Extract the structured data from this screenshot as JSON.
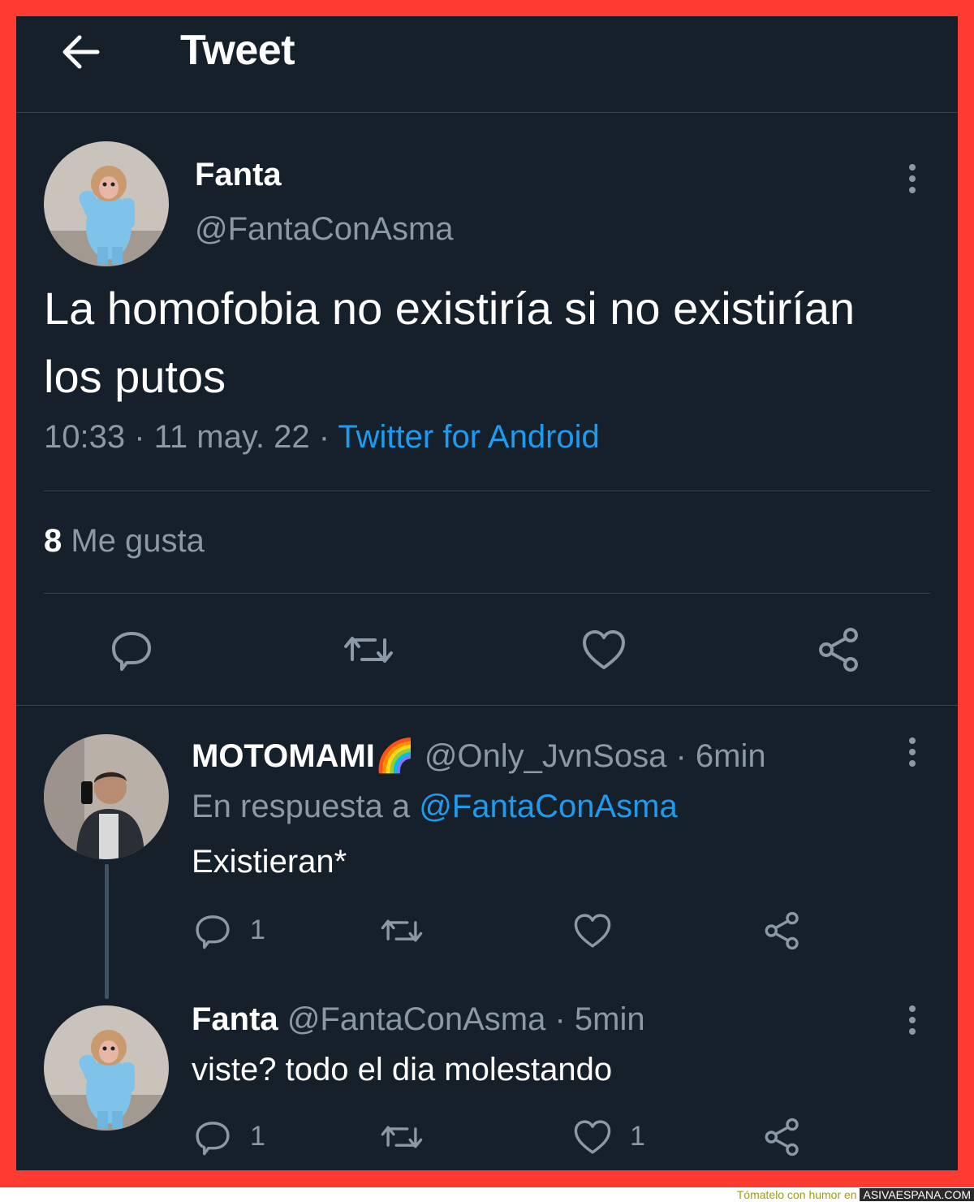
{
  "header": {
    "title": "Tweet"
  },
  "tweet": {
    "name": "Fanta",
    "handle": "@FantaConAsma",
    "text": "La homofobia no existiría si no existirían los putos",
    "time": "10:33 · 11 may. 22 · ",
    "source": "Twitter for Android",
    "likes_count": "8",
    "likes_label": "Me gusta"
  },
  "replies": [
    {
      "name": "MOTOMAMI🌈",
      "handle": "@Only_JvnSosa",
      "time": "· 6min",
      "reply_to_label": "En respuesta a",
      "reply_to": "@FantaConAsma",
      "text": "Existieran*",
      "reply_count": "1",
      "retweet_count": "",
      "like_count": ""
    },
    {
      "name": "Fanta",
      "handle": "@FantaConAsma",
      "time": "· 5min",
      "text": "viste? todo el dia molestando",
      "reply_count": "1",
      "retweet_count": "",
      "like_count": "1"
    }
  ],
  "footer": {
    "prefix": "Tómatelo con humor en",
    "site": "ASIVAESPANA.COM"
  },
  "colors": {
    "background": "#15202b",
    "accent": "#1d9bf0",
    "muted": "#8b98a5",
    "border": "#ff3a30"
  }
}
